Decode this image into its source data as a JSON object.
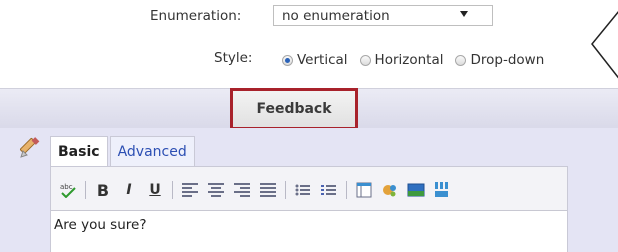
{
  "form": {
    "enumeration_label": "Enumeration:",
    "enumeration_value": "no enumeration",
    "style_label": "Style:",
    "style_options": [
      {
        "label": "Vertical",
        "checked": true
      },
      {
        "label": "Horizontal",
        "checked": false
      },
      {
        "label": "Drop-down",
        "checked": false
      }
    ]
  },
  "section": {
    "feedback_tab": "Feedback"
  },
  "editor": {
    "tabs": [
      "Basic",
      "Advanced"
    ],
    "active_tab": "Basic",
    "toolbar": {
      "spell_icon": "abc",
      "bold": "B",
      "italic": "I",
      "underline": "U"
    },
    "text": "Are you sure?"
  },
  "colors": {
    "highlight_border": "#a8222b",
    "link": "#2c4fb3",
    "background": "#e4e4f4"
  }
}
